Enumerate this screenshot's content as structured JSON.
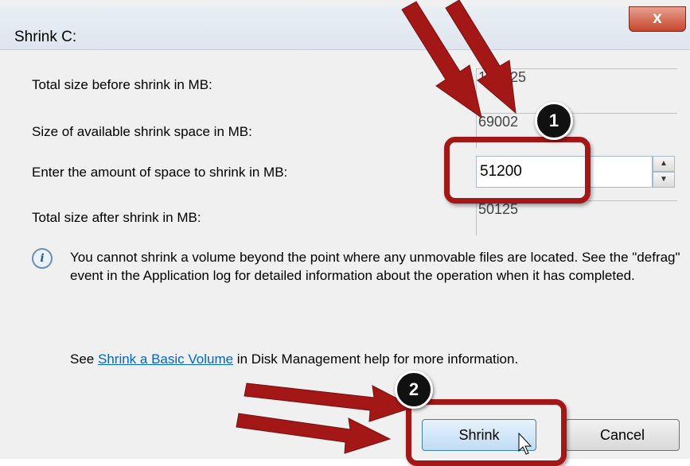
{
  "window": {
    "title": "Shrink C:",
    "close_icon": "x"
  },
  "fields": [
    {
      "label": "Total size before shrink in MB:",
      "value": "101325"
    },
    {
      "label": "Size of available shrink space in MB:",
      "value": "69002"
    },
    {
      "label": "Enter the amount of space to shrink in MB:",
      "value": "51200"
    },
    {
      "label": "Total size after shrink in MB:",
      "value": "50125"
    }
  ],
  "info": "You cannot shrink a volume beyond the point where any unmovable files are located. See the \"defrag\" event in the Application log for detailed information about the operation when it has completed.",
  "help": {
    "prefix": "See ",
    "link": "Shrink a Basic Volume",
    "suffix": " in Disk Management help for more information."
  },
  "buttons": {
    "shrink": "Shrink",
    "cancel": "Cancel"
  },
  "annotations": {
    "step1": "1",
    "step2": "2",
    "color": "#a31717"
  }
}
